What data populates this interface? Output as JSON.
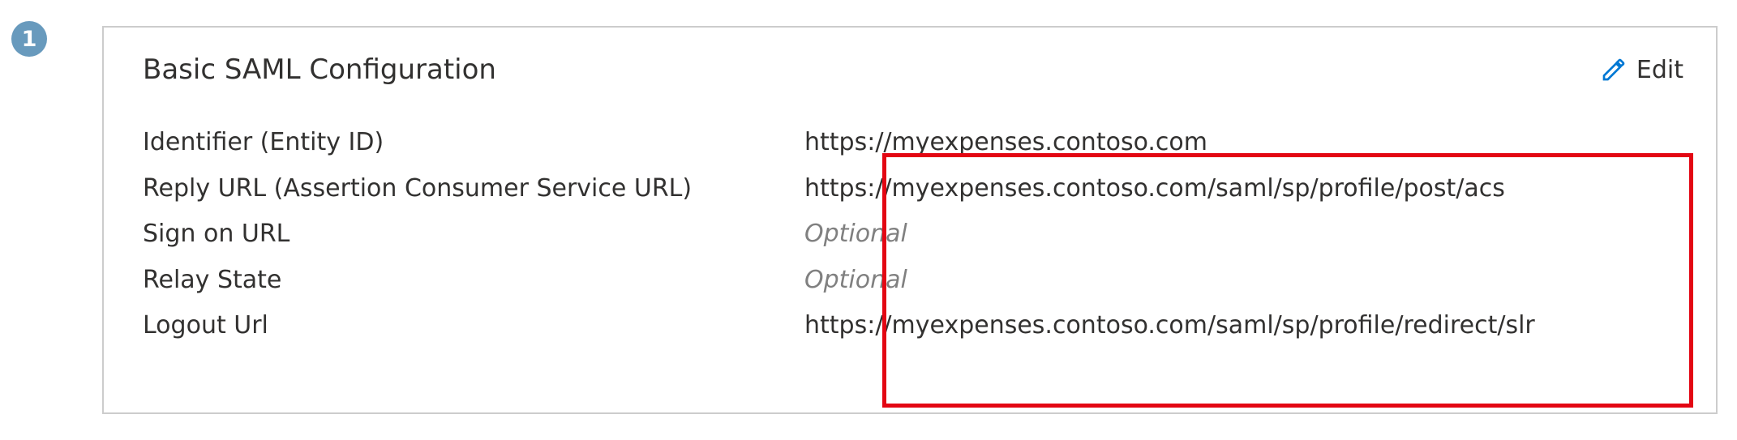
{
  "step_number": "1",
  "card": {
    "title": "Basic SAML Configuration",
    "edit_label": "Edit"
  },
  "fields": {
    "identifier": {
      "label": "Identifier (Entity ID)",
      "value": "https://myexpenses.contoso.com",
      "optional": false
    },
    "reply_url": {
      "label": "Reply URL (Assertion Consumer Service URL)",
      "value": "https://myexpenses.contoso.com/saml/sp/profile/post/acs",
      "optional": false
    },
    "sign_on_url": {
      "label": "Sign on URL",
      "value": "Optional",
      "optional": true
    },
    "relay_state": {
      "label": "Relay State",
      "value": "Optional",
      "optional": true
    },
    "logout_url": {
      "label": "Logout Url",
      "value": "https://myexpenses.contoso.com/saml/sp/profile/redirect/slr",
      "optional": false
    }
  }
}
